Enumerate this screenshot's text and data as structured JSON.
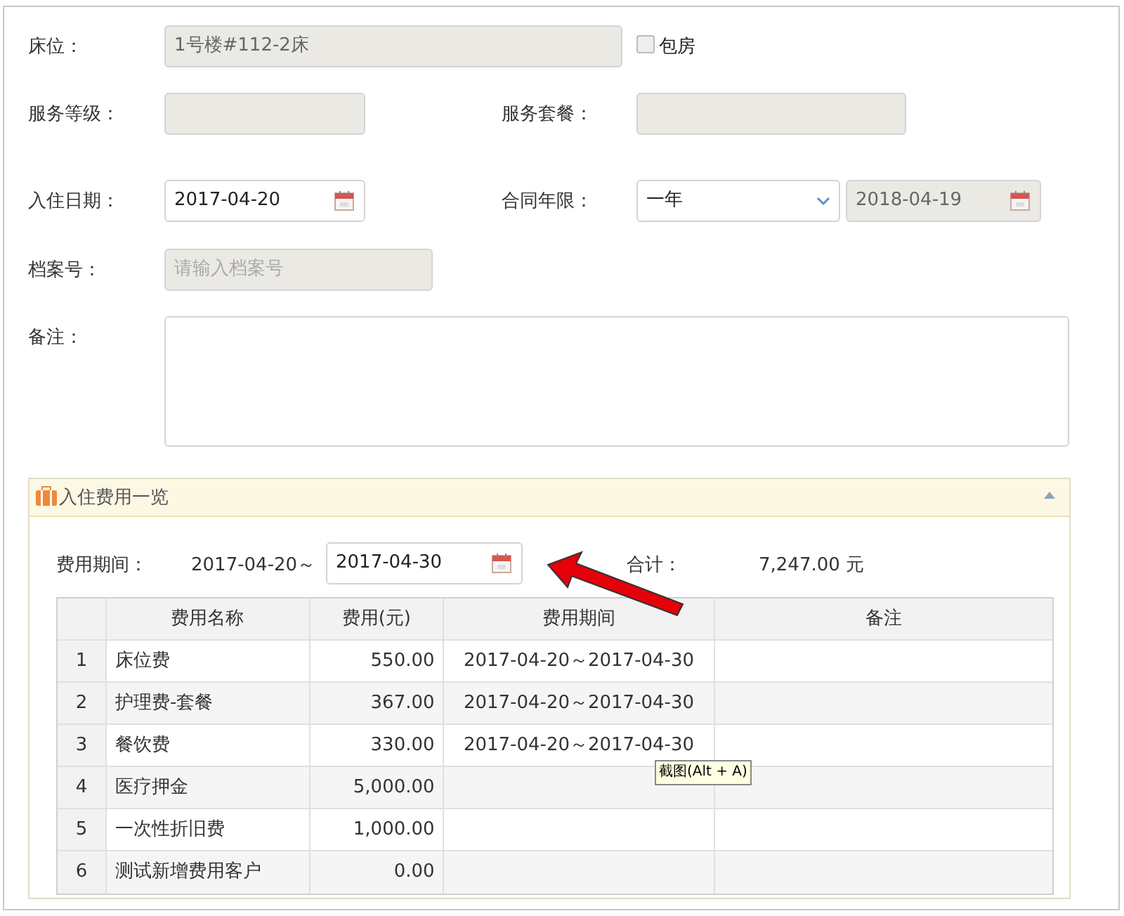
{
  "form": {
    "bed": {
      "label": "床位：",
      "value": "1号楼#112-2床"
    },
    "private_room": {
      "label": "包房",
      "checked": false
    },
    "service_level": {
      "label": "服务等级："
    },
    "service_package": {
      "label": "服务套餐："
    },
    "checkin_date": {
      "label": "入住日期：",
      "value": "2017-04-20"
    },
    "contract_term": {
      "label": "合同年限：",
      "value": "一年",
      "end_date": "2018-04-19"
    },
    "file_no": {
      "label": "档案号：",
      "placeholder": "请输入档案号"
    },
    "remarks": {
      "label": "备注："
    }
  },
  "fees_panel": {
    "title": "入住费用一览",
    "expanded": true,
    "period_label": "费用期间：",
    "period_start": "2017-04-20～",
    "period_end": "2017-04-30",
    "total_label": "合计：",
    "total": "7,247.00 元",
    "table": {
      "columns": [
        "费用名称",
        "费用(元)",
        "费用期间",
        "备注"
      ],
      "rows": [
        {
          "index": "1",
          "name": "床位费",
          "fee": "550.00",
          "period": "2017-04-20～2017-04-30"
        },
        {
          "index": "2",
          "name": "护理费-套餐",
          "fee": "367.00",
          "period": "2017-04-20～2017-04-30"
        },
        {
          "index": "3",
          "name": "餐饮费",
          "fee": "330.00",
          "period": "2017-04-20～2017-04-30"
        },
        {
          "index": "4",
          "name": "医疗押金",
          "fee": "5,000.00"
        },
        {
          "index": "5",
          "name": "一次性折旧费",
          "fee": "1,000.00"
        },
        {
          "index": "6",
          "name": "测试新增费用客户",
          "fee": "0.00"
        }
      ]
    }
  },
  "tooltip": "截图(Alt + A)"
}
